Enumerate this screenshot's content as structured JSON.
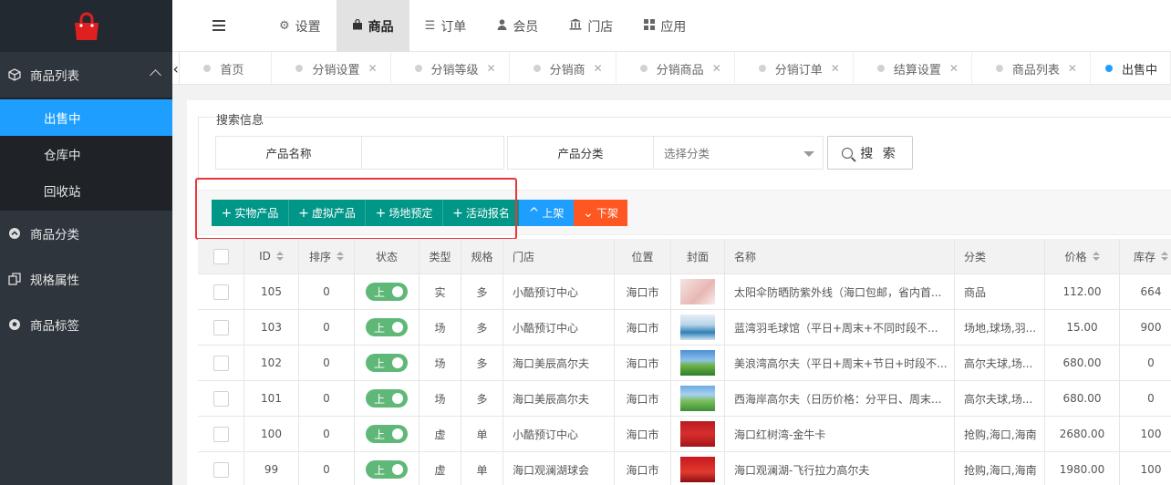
{
  "header": {
    "nav": [
      {
        "label": "设置",
        "icon": "gears-icon"
      },
      {
        "label": "商品",
        "icon": "bag-icon",
        "active": true
      },
      {
        "label": "订单",
        "icon": "list-icon"
      },
      {
        "label": "会员",
        "icon": "user-icon"
      },
      {
        "label": "门店",
        "icon": "bank-icon"
      },
      {
        "label": "应用",
        "icon": "grid-icon"
      }
    ]
  },
  "sidebar": {
    "groups": [
      {
        "label": "商品列表",
        "icon": "cube-icon"
      },
      {
        "label": "商品分类",
        "icon": "circle-up-icon"
      },
      {
        "label": "规格属性",
        "icon": "copy-icon"
      },
      {
        "label": "商品标签",
        "icon": "soccer-icon"
      }
    ],
    "sub_items": [
      {
        "label": "出售中",
        "active": true
      },
      {
        "label": "仓库中"
      },
      {
        "label": "回收站"
      }
    ]
  },
  "tabs": [
    {
      "label": "首页"
    },
    {
      "label": "分销设置"
    },
    {
      "label": "分销等级"
    },
    {
      "label": "分销商"
    },
    {
      "label": "分销商品"
    },
    {
      "label": "分销订单"
    },
    {
      "label": "结算设置"
    },
    {
      "label": "商品列表"
    },
    {
      "label": "出售中",
      "active": true
    }
  ],
  "search": {
    "legend": "搜索信息",
    "name_label": "产品名称",
    "name_value": "",
    "category_label": "产品分类",
    "category_placeholder": "选择分类",
    "button": "搜 索"
  },
  "toolbar": {
    "add_physical": "实物产品",
    "add_virtual": "虚拟产品",
    "add_venue": "场地预定",
    "add_event": "活动报名",
    "list_on": "上架",
    "list_off": "下架"
  },
  "table": {
    "columns": [
      "ID",
      "排序",
      "状态",
      "类型",
      "规格",
      "门店",
      "位置",
      "封面",
      "名称",
      "分类",
      "价格",
      "库存"
    ],
    "status_label": "上",
    "rows": [
      {
        "id": "105",
        "sort": "0",
        "type": "实",
        "spec": "多",
        "store": "小酷预订中心",
        "location": "海口市",
        "name": "太阳伞防晒防紫外线（海口包邮，省内首...",
        "category": "商品",
        "price": "112.00",
        "stock": "664"
      },
      {
        "id": "103",
        "sort": "0",
        "type": "场",
        "spec": "多",
        "store": "小酷预订中心",
        "location": "海口市",
        "name": "蓝湾羽毛球馆（平日+周末+不同时段不...",
        "category": "场地,球场,羽...",
        "price": "15.00",
        "stock": "900"
      },
      {
        "id": "102",
        "sort": "0",
        "type": "场",
        "spec": "多",
        "store": "海口美辰高尔夫",
        "location": "海口市",
        "name": "美浪湾高尔夫（平日+周末+节日+时段不...",
        "category": "高尔夫球,场...",
        "price": "680.00",
        "stock": "0"
      },
      {
        "id": "101",
        "sort": "0",
        "type": "场",
        "spec": "多",
        "store": "海口美辰高尔夫",
        "location": "海口市",
        "name": "西海岸高尔夫（日历价格：分平日、周末...",
        "category": "高尔夫球,场...",
        "price": "680.00",
        "stock": "0"
      },
      {
        "id": "100",
        "sort": "0",
        "type": "虚",
        "spec": "单",
        "store": "小酷预订中心",
        "location": "海口市",
        "name": "海口红树湾-金牛卡",
        "category": "抢购,海口,海南",
        "price": "2680.00",
        "stock": "100"
      },
      {
        "id": "99",
        "sort": "0",
        "type": "虚",
        "spec": "单",
        "store": "海口观澜湖球会",
        "location": "海口市",
        "name": "海口观澜湖-飞行拉力高尔夫",
        "category": "抢购,海口,海南",
        "price": "1980.00",
        "stock": "100"
      }
    ]
  },
  "colors": {
    "sidebar_bg": "#2f353d",
    "active_blue": "#1e9fff",
    "green_btn": "#009688",
    "orange_btn": "#ff5722",
    "switch_green": "#5fb878",
    "highlight_red": "#e8363b"
  }
}
